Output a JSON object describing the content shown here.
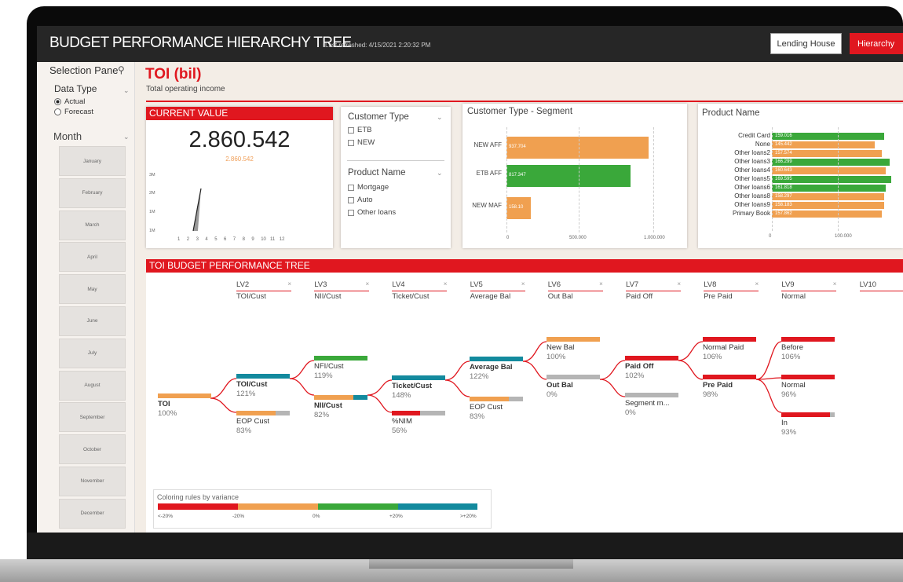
{
  "app": {
    "title": "BUDGET PERFORMANCE HIERARCHY TREE",
    "refreshed": "Last refreshed: 4/15/2021 2:20:32 PM",
    "btn_lending": "Lending House",
    "btn_hierarchy": "Hierarchy"
  },
  "side": {
    "title": "Selection Pane",
    "datatype_label": "Data Type",
    "radio_actual": "Actual",
    "radio_forecast": "Forecast",
    "month_label": "Month",
    "months": [
      "January",
      "February",
      "March",
      "April",
      "May",
      "June",
      "July",
      "August",
      "September",
      "October",
      "November",
      "December"
    ]
  },
  "header": {
    "title": "TOI (bil)",
    "subtitle": "Total operating income"
  },
  "current": {
    "head": "CURRENT VALUE",
    "value": "2.860.542",
    "subvalue": "2.860.542",
    "y_ticks": [
      "3M",
      "2M",
      "1M",
      "1M"
    ],
    "x_ticks": [
      "1",
      "2",
      "3",
      "4",
      "5",
      "6",
      "7",
      "8",
      "9",
      "10",
      "11",
      "12"
    ]
  },
  "slicers": {
    "customer_type": "Customer Type",
    "customer_options": [
      "ETB",
      "NEW"
    ],
    "product_name": "Product Name",
    "product_options": [
      "Mortgage",
      "Auto",
      "Other loans"
    ]
  },
  "segment": {
    "title": "Customer Type - Segment",
    "bars": [
      {
        "label": "NEW AFF",
        "value": "937.704",
        "fill": 0.937,
        "color": "#f0a050"
      },
      {
        "label": "ETB AFF",
        "value": "817.347",
        "fill": 0.817,
        "color": "#3aa83a"
      },
      {
        "label": "NEW MAF",
        "value": "158.10",
        "fill": 0.158,
        "color": "#f0a050"
      }
    ],
    "x_ticks": [
      "0",
      "500.000",
      "1.000.000"
    ]
  },
  "product": {
    "title": "Product Name",
    "rows": [
      {
        "label": "Credit Card",
        "value": "159.016",
        "fill": 0.62,
        "color": "#3aa83a"
      },
      {
        "label": "None",
        "value": "145.442",
        "fill": 0.57,
        "color": "#f0a050"
      },
      {
        "label": "Other loans2",
        "value": "157.574",
        "fill": 0.61,
        "color": "#f0a050"
      },
      {
        "label": "Other loans3",
        "value": "166.299",
        "fill": 0.65,
        "color": "#3aa83a"
      },
      {
        "label": "Other loans4",
        "value": "160.643",
        "fill": 0.63,
        "color": "#f0a050"
      },
      {
        "label": "Other loans5",
        "value": "169.595",
        "fill": 0.66,
        "color": "#3aa83a"
      },
      {
        "label": "Other loans6",
        "value": "161.818",
        "fill": 0.63,
        "color": "#3aa83a"
      },
      {
        "label": "Other loans8",
        "value": "158.297",
        "fill": 0.62,
        "color": "#f0a050"
      },
      {
        "label": "Other loans9",
        "value": "158.183",
        "fill": 0.62,
        "color": "#f0a050"
      },
      {
        "label": "Primary Book",
        "value": "157.862",
        "fill": 0.61,
        "color": "#f0a050"
      }
    ],
    "x_ticks": [
      "0",
      "100.000"
    ]
  },
  "tree": {
    "head": "TOI BUDGET PERFORMANCE TREE",
    "levels": [
      {
        "t": "LV2",
        "s": "TOI/Cust"
      },
      {
        "t": "LV3",
        "s": "NII/Cust"
      },
      {
        "t": "LV4",
        "s": "Ticket/Cust"
      },
      {
        "t": "LV5",
        "s": "Average Bal"
      },
      {
        "t": "LV6",
        "s": "Out Bal"
      },
      {
        "t": "LV7",
        "s": "Paid Off"
      },
      {
        "t": "LV8",
        "s": "Pre Paid"
      },
      {
        "t": "LV9",
        "s": "Normal"
      },
      {
        "t": "LV10",
        "s": ""
      }
    ],
    "nodes": {
      "toi": {
        "l": "TOI",
        "p": "100%"
      },
      "toicust": {
        "l": "TOI/Cust",
        "p": "121%"
      },
      "eopcust1": {
        "l": "EOP Cust",
        "p": "83%"
      },
      "nficust": {
        "l": "NFI/Cust",
        "p": "119%"
      },
      "niicust": {
        "l": "NII/Cust",
        "p": "82%"
      },
      "ticket": {
        "l": "Ticket/Cust",
        "p": "148%"
      },
      "nim": {
        "l": "%NIM",
        "p": "56%"
      },
      "avgbal": {
        "l": "Average Bal",
        "p": "122%"
      },
      "eopcust2": {
        "l": "EOP Cust",
        "p": "83%"
      },
      "newbal": {
        "l": "New Bal",
        "p": "100%"
      },
      "outbal": {
        "l": "Out Bal",
        "p": "0%"
      },
      "paidoff": {
        "l": "Paid Off",
        "p": "102%"
      },
      "segm": {
        "l": "Segment m...",
        "p": "0%"
      },
      "normalpaid": {
        "l": "Normal Paid",
        "p": "106%"
      },
      "prepaid": {
        "l": "Pre Paid",
        "p": "98%"
      },
      "before": {
        "l": "Before",
        "p": "106%"
      },
      "normal": {
        "l": "Normal",
        "p": "96%"
      },
      "in": {
        "l": "In",
        "p": "93%"
      }
    }
  },
  "legend": {
    "title": "Coloring rules by variance",
    "labels": [
      "<-20%",
      "-20%",
      "0%",
      "+20%",
      ">+20%"
    ]
  },
  "colors": {
    "accent": "#e0171f",
    "orange": "#f0a050",
    "green": "#3aa83a",
    "teal": "#138a9e",
    "gray": "#b5b5b5"
  }
}
